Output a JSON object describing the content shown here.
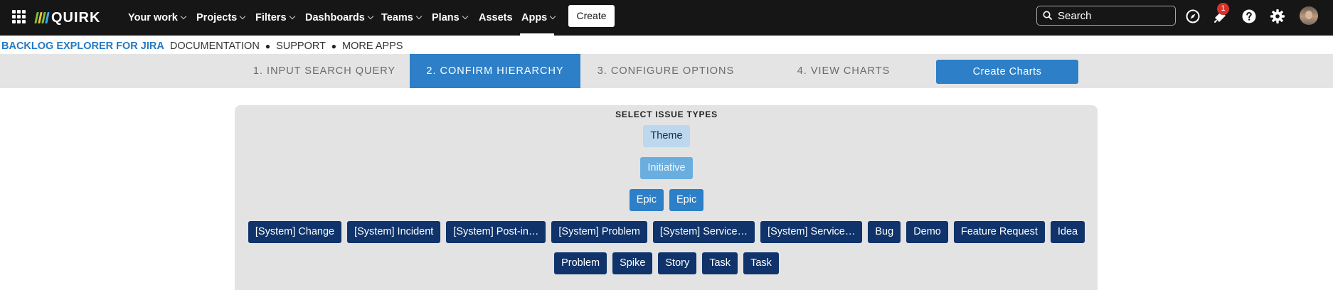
{
  "nav": {
    "logo_text": "QUIRK",
    "logo_colors": [
      "#7bc043",
      "#f2c12e",
      "#7bc043",
      "#3fa9f5"
    ],
    "items": [
      {
        "label": "Your work"
      },
      {
        "label": "Projects"
      },
      {
        "label": "Filters"
      },
      {
        "label": "Dashboards"
      },
      {
        "label": "Teams"
      },
      {
        "label": "Plans"
      },
      {
        "label": "Assets"
      },
      {
        "label": "Apps"
      }
    ],
    "create_label": "Create",
    "search_placeholder": "Search",
    "notification_count": "1",
    "icons": [
      "apps-grid-icon",
      "compass-icon",
      "notifications-icon",
      "help-icon",
      "settings-icon",
      "avatar"
    ]
  },
  "app_header": {
    "title": "BACKLOG EXPLORER FOR JIRA",
    "links": [
      "DOCUMENTATION",
      "SUPPORT",
      "MORE APPS"
    ],
    "separator": "●"
  },
  "steps": [
    {
      "label": "1. INPUT SEARCH QUERY",
      "active": false
    },
    {
      "label": "2. CONFIRM HIERARCHY",
      "active": true
    },
    {
      "label": "3. CONFIGURE OPTIONS",
      "active": false
    },
    {
      "label": "4. VIEW CHARTS",
      "active": false
    }
  ],
  "create_charts_label": "Create Charts",
  "hierarchy": {
    "title": "SELECT ISSUE TYPES",
    "levels": [
      [
        "Theme"
      ],
      [
        "Initiative"
      ],
      [
        "Epic",
        "Epic"
      ],
      [
        "[System] Change",
        "[System] Incident",
        "[System] Post-in…",
        "[System] Problem",
        "[System] Service…",
        "[System] Service…",
        "Bug",
        "Demo",
        "Feature Request",
        "Idea"
      ],
      [
        "Problem",
        "Spike",
        "Story",
        "Task",
        "Task"
      ]
    ]
  },
  "colors": {
    "nav_bg": "#161616",
    "accent_blue": "#2d7fc7",
    "level1": "#bcd7ee",
    "level2": "#6aaee0",
    "level3": "#2d7fc7",
    "level4": "#0f336a",
    "panel_bg": "#e3e3e3",
    "badge": "#d9322a"
  }
}
